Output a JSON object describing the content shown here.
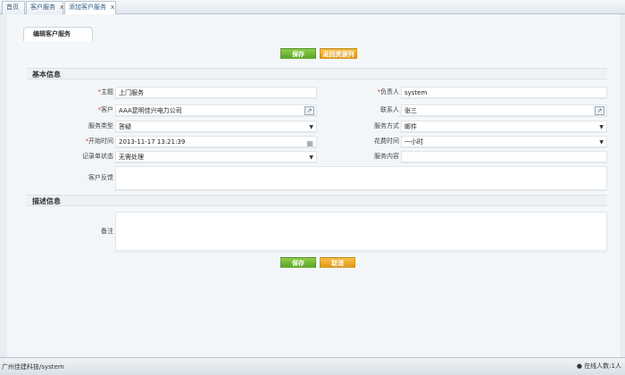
{
  "tabs": [
    {
      "label": "首页",
      "closable": false
    },
    {
      "label": "客户服务",
      "closable": true
    },
    {
      "label": "添加客户服务",
      "closable": true,
      "active": true
    }
  ],
  "tab_close_glyph": "x",
  "panel_title": "编辑客户服务",
  "toolbar": {
    "save_label": "保存",
    "back_label": "返回资源列"
  },
  "sections": {
    "basic": "基本信息",
    "desc": "描述信息"
  },
  "fields": {
    "subject": {
      "label": "主题",
      "value": "上门服务",
      "required": true
    },
    "owner": {
      "label": "负责人",
      "value": "system",
      "required": true
    },
    "customer": {
      "label": "客户",
      "value": "AAA昆明佳兴电力公司",
      "required": true
    },
    "contact": {
      "label": "联系人",
      "value": "张三",
      "required": false
    },
    "service_type": {
      "label": "服务类型",
      "value": "答疑",
      "required": false
    },
    "service_method": {
      "label": "服务方式",
      "value": "邮件",
      "required": false
    },
    "start_time": {
      "label": "开始时间",
      "value": "2013-11-17 13:21:39",
      "required": true
    },
    "duration": {
      "label": "花费时间",
      "value": "一小时",
      "required": false
    },
    "record_status": {
      "label": "记录单状态",
      "value": "无需处理",
      "required": false
    },
    "service_content": {
      "label": "服务内容",
      "value": "",
      "required": false
    },
    "customer_feedback": {
      "label": "客户反馈",
      "value": "",
      "required": false
    },
    "remark": {
      "label": "备注",
      "value": "",
      "required": false
    }
  },
  "required_mark": "*",
  "bottom_buttons": {
    "save_label": "保存",
    "cancel_label": "取消"
  },
  "status": {
    "left": "广州佳建科技/system",
    "right": "在线人数:1人"
  },
  "colors": {
    "accent_green": "#5ba52a",
    "accent_orange": "#e39a16",
    "required": "#ee3333"
  },
  "icons": {
    "picker": "lookup-icon",
    "calendar": "calendar-icon",
    "dropdown": "chevron-down-icon",
    "online": "user-icon"
  }
}
